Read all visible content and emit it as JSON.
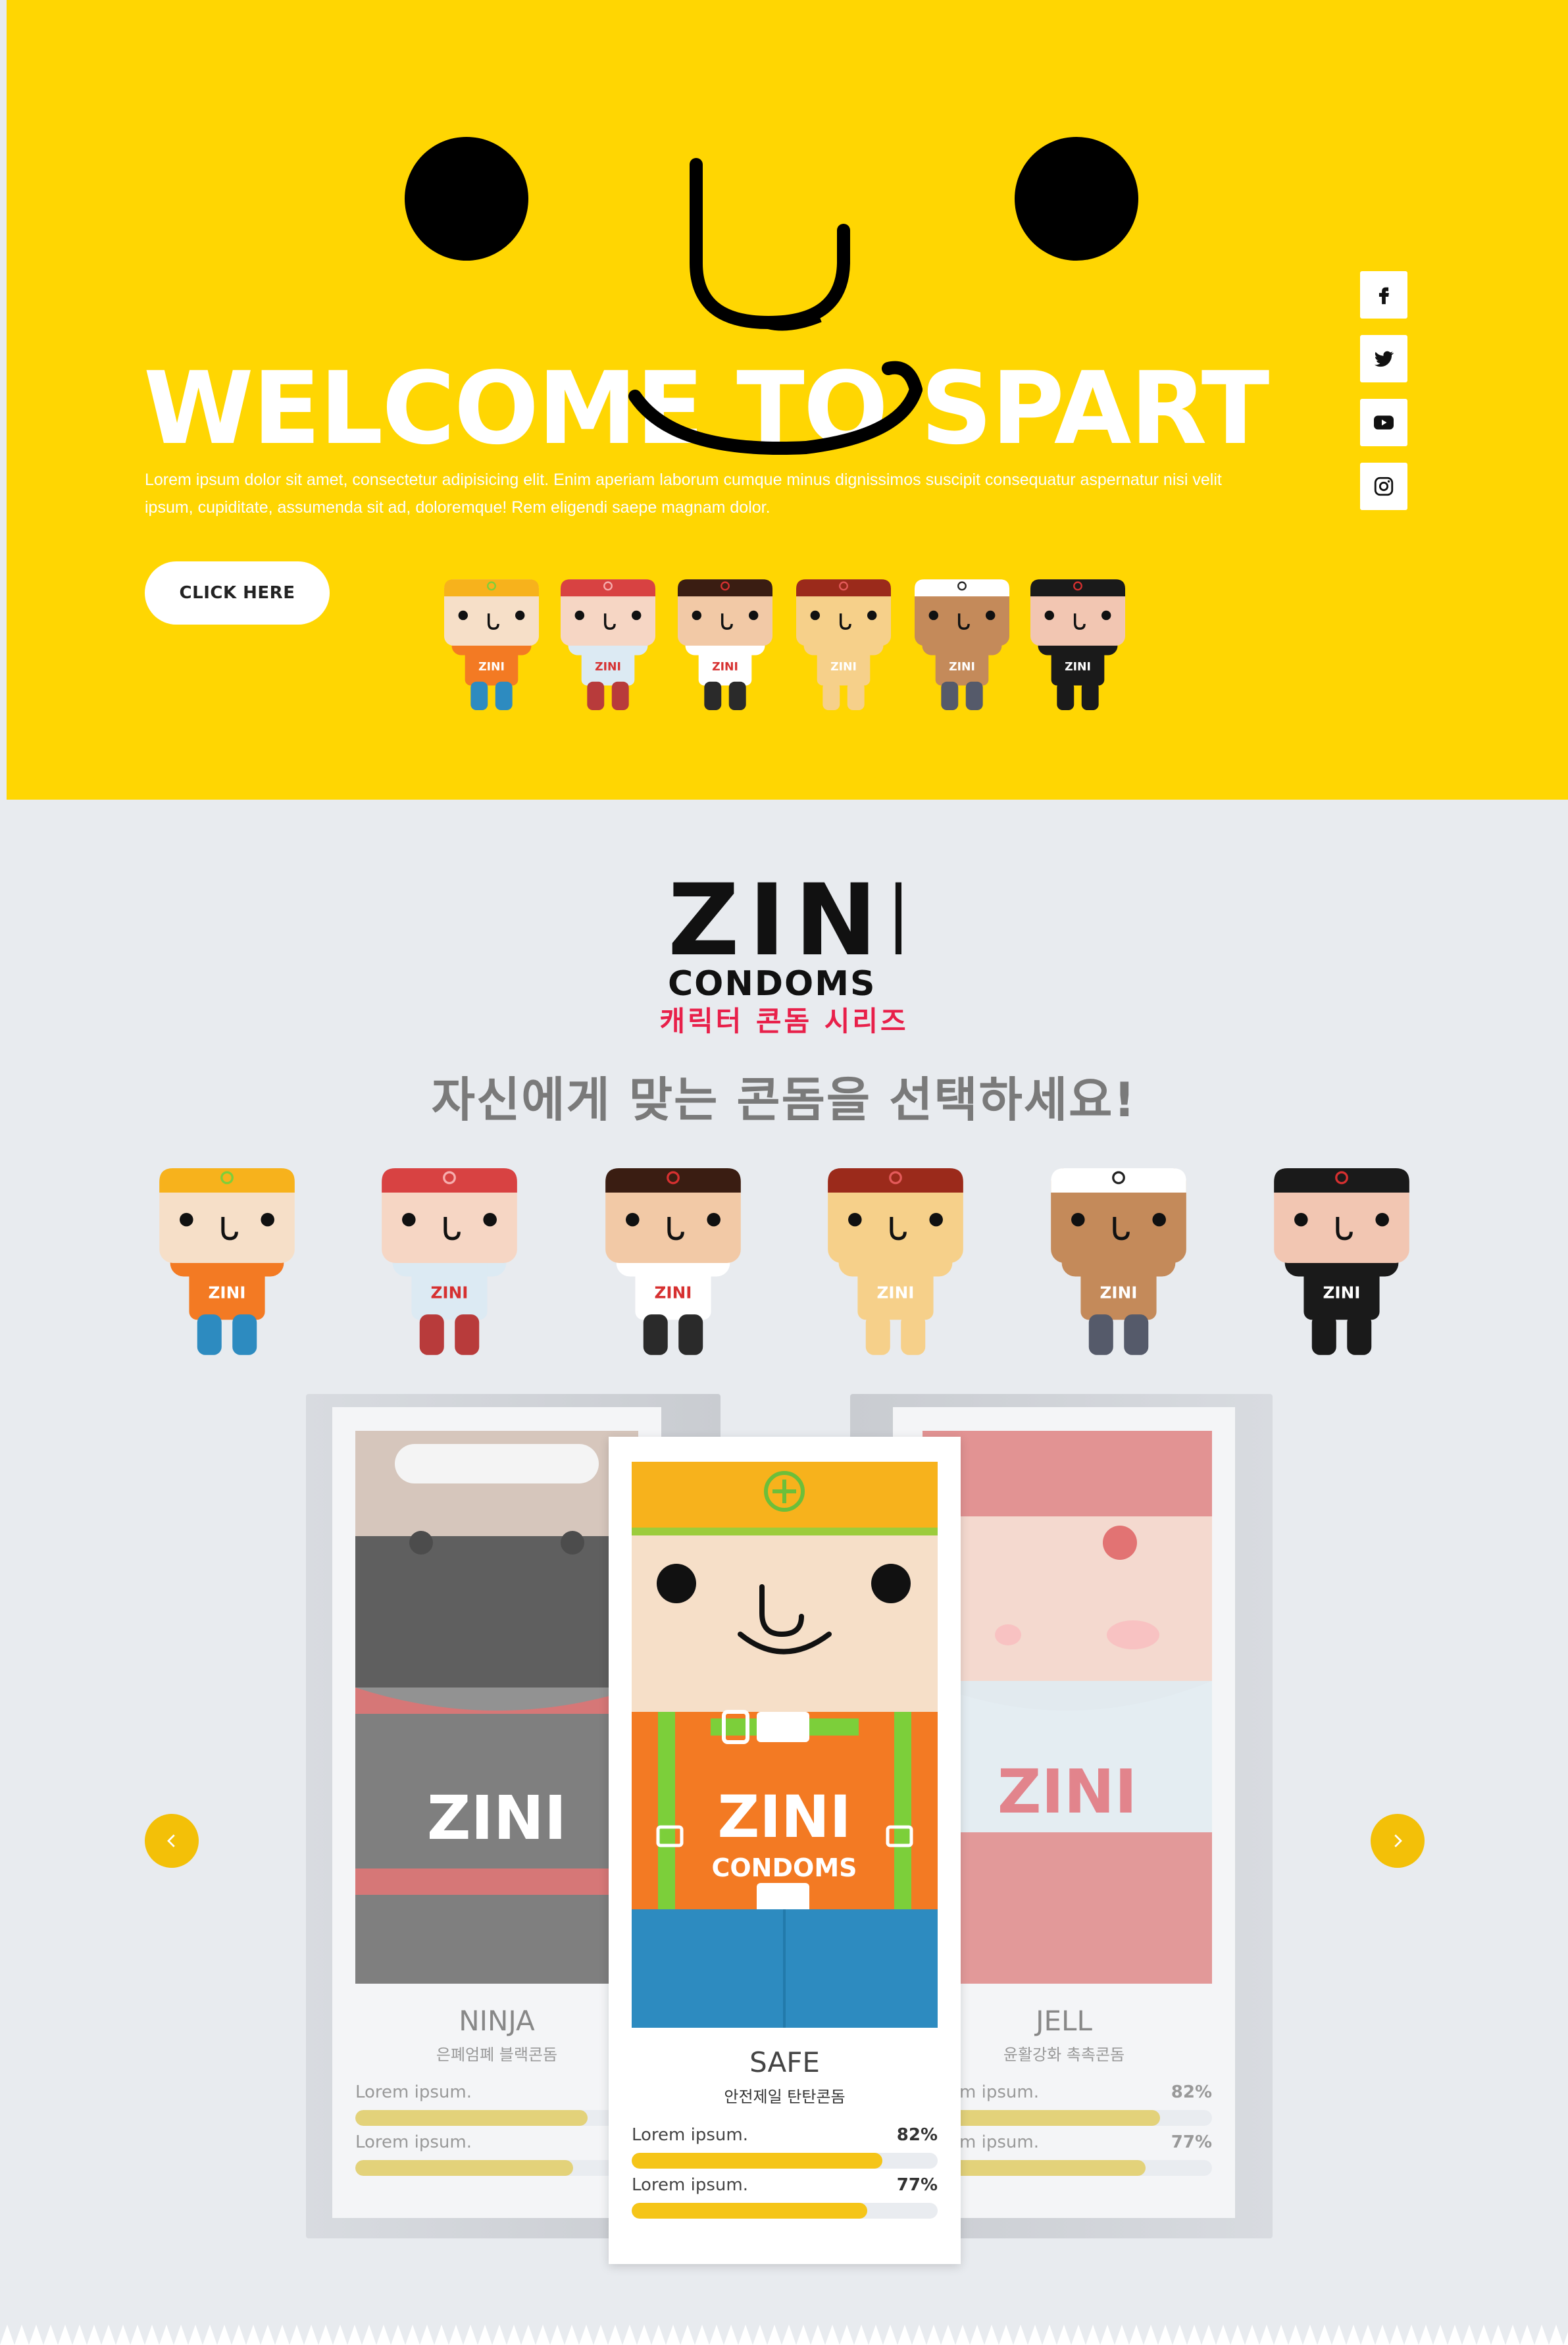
{
  "hero": {
    "title": "WELCOME TO SPART",
    "body": "Lorem ipsum dolor sit amet, consectetur adipisicing elit. Enim aperiam laborum cumque minus dignissimos suscipit consequatur aspernatur nisi velit ipsum, cupiditate, assumenda sit ad, doloremque! Rem eligendi saepe magnam dolor.",
    "cta_label": "CLICK HERE",
    "background": "#ffd602",
    "social": [
      "facebook-icon",
      "twitter-icon",
      "youtube-icon",
      "instagram-icon"
    ]
  },
  "brand": {
    "logo_main": "ZINI",
    "logo_sub": "CONDOMS",
    "tagline": "캐릭터 콘돔 시리즈",
    "heading": "자신에게 맞는 콘돔을 선택하세요!",
    "accent": "#e8204a"
  },
  "characters": [
    "safe",
    "jell",
    "tie",
    "naked",
    "muscle",
    "ninja"
  ],
  "carousel": {
    "cards": [
      {
        "name": "NINJA",
        "subtitle": "은폐엄폐 블랙콘돔",
        "stats": [
          {
            "label": "Lorem ipsum.",
            "value": 82,
            "value_text": "82%"
          },
          {
            "label": "Lorem ipsum.",
            "value": 77,
            "value_text": "77%"
          }
        ]
      },
      {
        "name": "SAFE",
        "subtitle": "안전제일 탄탄콘돔",
        "stats": [
          {
            "label": "Lorem ipsum.",
            "value": 82,
            "value_text": "82%"
          },
          {
            "label": "Lorem ipsum.",
            "value": 77,
            "value_text": "77%"
          }
        ]
      },
      {
        "name": "JELL",
        "subtitle": "윤활강화 촉촉콘돔",
        "stats": [
          {
            "label": "Lorem ipsum.",
            "value": 82,
            "value_text": "82%"
          },
          {
            "label": "Lorem ipsum.",
            "value": 77,
            "value_text": "77%"
          }
        ]
      }
    ],
    "prev_icon": "chevron-left-icon",
    "next_icon": "chevron-right-icon",
    "bar_color": "#f5c518"
  }
}
